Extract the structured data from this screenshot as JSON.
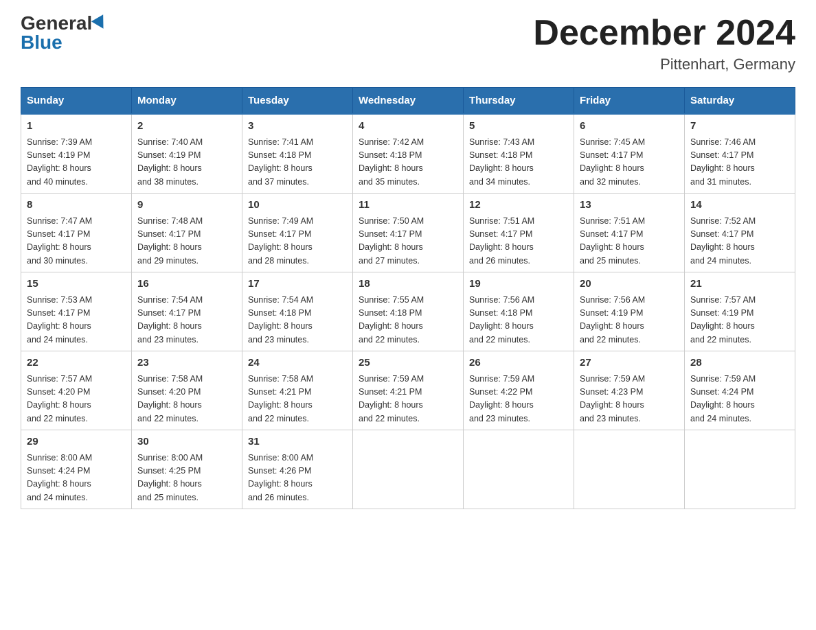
{
  "header": {
    "logo_general": "General",
    "logo_blue": "Blue",
    "month_title": "December 2024",
    "location": "Pittenhart, Germany"
  },
  "days_of_week": [
    "Sunday",
    "Monday",
    "Tuesday",
    "Wednesday",
    "Thursday",
    "Friday",
    "Saturday"
  ],
  "weeks": [
    [
      {
        "day": "1",
        "sunrise": "7:39 AM",
        "sunset": "4:19 PM",
        "daylight": "8 hours and 40 minutes."
      },
      {
        "day": "2",
        "sunrise": "7:40 AM",
        "sunset": "4:19 PM",
        "daylight": "8 hours and 38 minutes."
      },
      {
        "day": "3",
        "sunrise": "7:41 AM",
        "sunset": "4:18 PM",
        "daylight": "8 hours and 37 minutes."
      },
      {
        "day": "4",
        "sunrise": "7:42 AM",
        "sunset": "4:18 PM",
        "daylight": "8 hours and 35 minutes."
      },
      {
        "day": "5",
        "sunrise": "7:43 AM",
        "sunset": "4:18 PM",
        "daylight": "8 hours and 34 minutes."
      },
      {
        "day": "6",
        "sunrise": "7:45 AM",
        "sunset": "4:17 PM",
        "daylight": "8 hours and 32 minutes."
      },
      {
        "day": "7",
        "sunrise": "7:46 AM",
        "sunset": "4:17 PM",
        "daylight": "8 hours and 31 minutes."
      }
    ],
    [
      {
        "day": "8",
        "sunrise": "7:47 AM",
        "sunset": "4:17 PM",
        "daylight": "8 hours and 30 minutes."
      },
      {
        "day": "9",
        "sunrise": "7:48 AM",
        "sunset": "4:17 PM",
        "daylight": "8 hours and 29 minutes."
      },
      {
        "day": "10",
        "sunrise": "7:49 AM",
        "sunset": "4:17 PM",
        "daylight": "8 hours and 28 minutes."
      },
      {
        "day": "11",
        "sunrise": "7:50 AM",
        "sunset": "4:17 PM",
        "daylight": "8 hours and 27 minutes."
      },
      {
        "day": "12",
        "sunrise": "7:51 AM",
        "sunset": "4:17 PM",
        "daylight": "8 hours and 26 minutes."
      },
      {
        "day": "13",
        "sunrise": "7:51 AM",
        "sunset": "4:17 PM",
        "daylight": "8 hours and 25 minutes."
      },
      {
        "day": "14",
        "sunrise": "7:52 AM",
        "sunset": "4:17 PM",
        "daylight": "8 hours and 24 minutes."
      }
    ],
    [
      {
        "day": "15",
        "sunrise": "7:53 AM",
        "sunset": "4:17 PM",
        "daylight": "8 hours and 24 minutes."
      },
      {
        "day": "16",
        "sunrise": "7:54 AM",
        "sunset": "4:17 PM",
        "daylight": "8 hours and 23 minutes."
      },
      {
        "day": "17",
        "sunrise": "7:54 AM",
        "sunset": "4:18 PM",
        "daylight": "8 hours and 23 minutes."
      },
      {
        "day": "18",
        "sunrise": "7:55 AM",
        "sunset": "4:18 PM",
        "daylight": "8 hours and 22 minutes."
      },
      {
        "day": "19",
        "sunrise": "7:56 AM",
        "sunset": "4:18 PM",
        "daylight": "8 hours and 22 minutes."
      },
      {
        "day": "20",
        "sunrise": "7:56 AM",
        "sunset": "4:19 PM",
        "daylight": "8 hours and 22 minutes."
      },
      {
        "day": "21",
        "sunrise": "7:57 AM",
        "sunset": "4:19 PM",
        "daylight": "8 hours and 22 minutes."
      }
    ],
    [
      {
        "day": "22",
        "sunrise": "7:57 AM",
        "sunset": "4:20 PM",
        "daylight": "8 hours and 22 minutes."
      },
      {
        "day": "23",
        "sunrise": "7:58 AM",
        "sunset": "4:20 PM",
        "daylight": "8 hours and 22 minutes."
      },
      {
        "day": "24",
        "sunrise": "7:58 AM",
        "sunset": "4:21 PM",
        "daylight": "8 hours and 22 minutes."
      },
      {
        "day": "25",
        "sunrise": "7:59 AM",
        "sunset": "4:21 PM",
        "daylight": "8 hours and 22 minutes."
      },
      {
        "day": "26",
        "sunrise": "7:59 AM",
        "sunset": "4:22 PM",
        "daylight": "8 hours and 23 minutes."
      },
      {
        "day": "27",
        "sunrise": "7:59 AM",
        "sunset": "4:23 PM",
        "daylight": "8 hours and 23 minutes."
      },
      {
        "day": "28",
        "sunrise": "7:59 AM",
        "sunset": "4:24 PM",
        "daylight": "8 hours and 24 minutes."
      }
    ],
    [
      {
        "day": "29",
        "sunrise": "8:00 AM",
        "sunset": "4:24 PM",
        "daylight": "8 hours and 24 minutes."
      },
      {
        "day": "30",
        "sunrise": "8:00 AM",
        "sunset": "4:25 PM",
        "daylight": "8 hours and 25 minutes."
      },
      {
        "day": "31",
        "sunrise": "8:00 AM",
        "sunset": "4:26 PM",
        "daylight": "8 hours and 26 minutes."
      },
      null,
      null,
      null,
      null
    ]
  ],
  "labels": {
    "sunrise": "Sunrise:",
    "sunset": "Sunset:",
    "daylight": "Daylight:"
  }
}
